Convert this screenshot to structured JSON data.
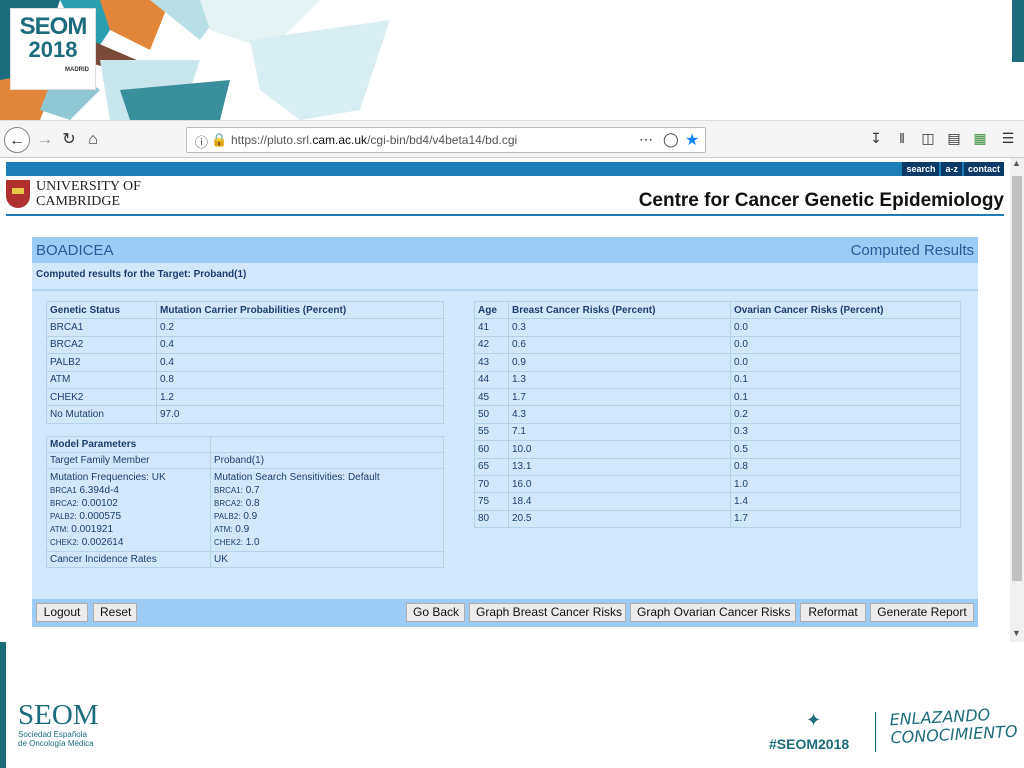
{
  "slide": {
    "logo_line1": "SEOM",
    "logo_line2": "2018",
    "logo_city": "MADRID",
    "footer_org": "SEOM",
    "footer_org_line1": "Sociedad Española",
    "footer_org_line2": "de Oncología Médica",
    "hashtag": "#SEOM2018",
    "slogan_line1": "ENLAZANDO",
    "slogan_line2": "CONOCIMIENTO"
  },
  "browser": {
    "url_prefix": "https://pluto.srl.",
    "url_domain": "cam.ac.uk",
    "url_path": "/cgi-bin/bd4/v4beta14/bd.cgi",
    "icons": {
      "back": "back-arrow-icon",
      "forward": "forward-arrow-icon",
      "reload": "reload-icon",
      "home": "home-icon",
      "bookmark": "star-icon"
    }
  },
  "site": {
    "nav": [
      "search",
      "a-z",
      "contact"
    ],
    "university_line1": "UNIVERSITY OF",
    "university_line2": "CAMBRIDGE",
    "title": "Centre for Cancer Genetic Epidemiology"
  },
  "panel": {
    "title_left": "BOADICEA",
    "title_right": "Computed Results",
    "subtitle": "Computed results for the Target: Proband(1)"
  },
  "carrier_table": {
    "headers": [
      "Genetic Status",
      "Mutation Carrier Probabilities (Percent)"
    ],
    "rows": [
      [
        "BRCA1",
        "0.2"
      ],
      [
        "BRCA2",
        "0.4"
      ],
      [
        "PALB2",
        "0.4"
      ],
      [
        "ATM",
        "0.8"
      ],
      [
        "CHEK2",
        "1.2"
      ],
      [
        "No Mutation",
        "97.0"
      ]
    ]
  },
  "model_parameters": {
    "header": "Model Parameters",
    "target_label": "Target Family Member",
    "target_value": "Proband(1)",
    "freq_title": "Mutation Frequencies: UK",
    "sens_title": "Mutation Search Sensitivities: Default",
    "freq": [
      {
        "gene": "BRCA1",
        "value": "6.394d-4"
      },
      {
        "gene": "BRCA2:",
        "value": "0.00102"
      },
      {
        "gene": "PALB2:",
        "value": "0.000575"
      },
      {
        "gene": "ATM:",
        "value": "0.001921"
      },
      {
        "gene": "CHEK2:",
        "value": "0.002614"
      }
    ],
    "sens": [
      {
        "gene": "BRCA1:",
        "value": "0.7"
      },
      {
        "gene": "BRCA2:",
        "value": "0.8"
      },
      {
        "gene": "PALB2:",
        "value": "0.9"
      },
      {
        "gene": "ATM:",
        "value": "0.9"
      },
      {
        "gene": "CHEK2:",
        "value": "1.0"
      }
    ],
    "incidence_label": "Cancer Incidence Rates",
    "incidence_value": "UK"
  },
  "risk_table": {
    "headers": [
      "Age",
      "Breast Cancer Risks (Percent)",
      "Ovarian Cancer Risks (Percent)"
    ],
    "rows": [
      [
        "41",
        "0.3",
        "0.0"
      ],
      [
        "42",
        "0.6",
        "0.0"
      ],
      [
        "43",
        "0.9",
        "0.0"
      ],
      [
        "44",
        "1.3",
        "0.1"
      ],
      [
        "45",
        "1.7",
        "0.1"
      ],
      [
        "50",
        "4.3",
        "0.2"
      ],
      [
        "55",
        "7.1",
        "0.3"
      ],
      [
        "60",
        "10.0",
        "0.5"
      ],
      [
        "65",
        "13.1",
        "0.8"
      ],
      [
        "70",
        "16.0",
        "1.0"
      ],
      [
        "75",
        "18.4",
        "1.4"
      ],
      [
        "80",
        "20.5",
        "1.7"
      ]
    ]
  },
  "buttons": {
    "logout": "Logout",
    "reset": "Reset",
    "go_back": "Go Back",
    "graph_breast": "Graph Breast Cancer Risks",
    "graph_ovarian": "Graph Ovarian Cancer Risks",
    "reformat": "Reformat",
    "generate_report": "Generate Report"
  }
}
